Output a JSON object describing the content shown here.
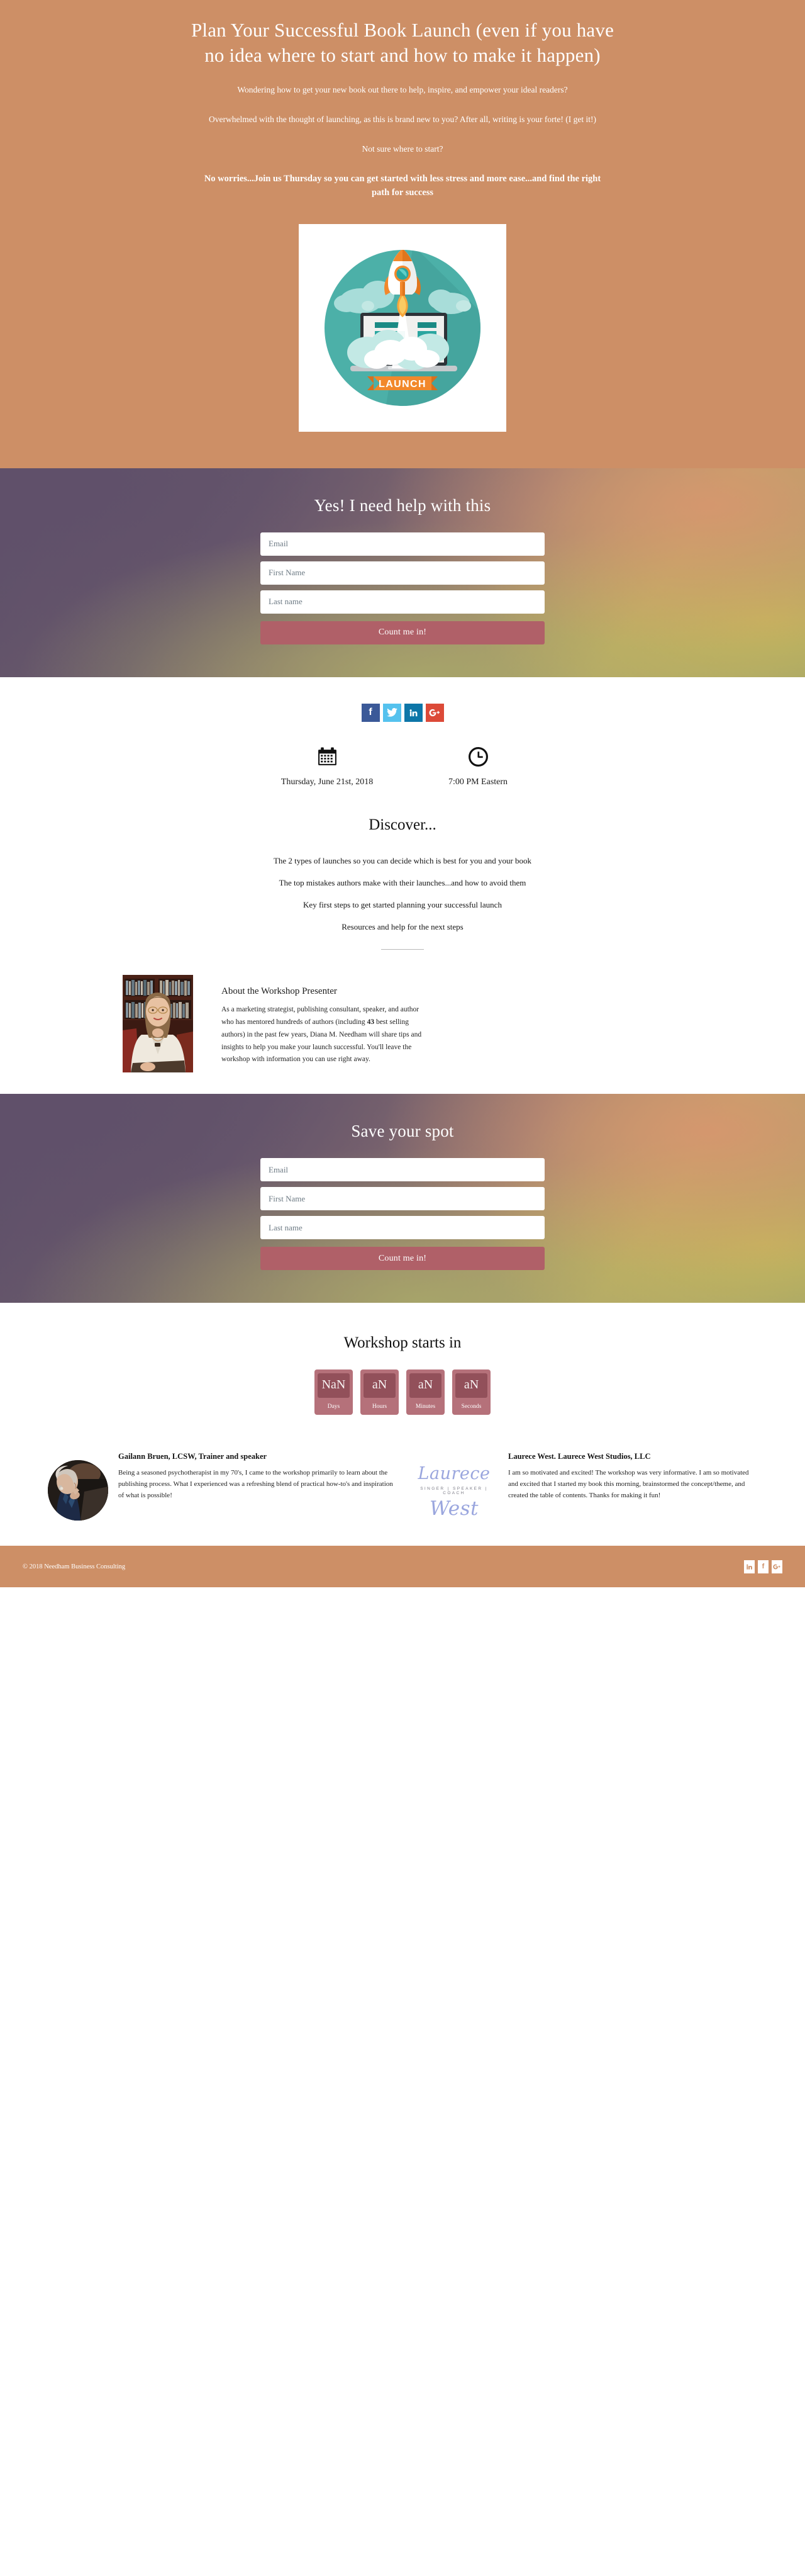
{
  "hero": {
    "title": "Plan Your Successful Book Launch (even if you have no idea where to start and how to make it happen)",
    "sub1": "Wondering how to get your new book out there to help, inspire, and empower your ideal readers?",
    "sub2": "Overwhelmed with the thought of launching, as this is brand new to you? After all, writing is your forte!  (I get it!)",
    "sub3": "Not sure where to start?",
    "sub4": "No worries...Join us Thursday so you can get started with less stress and more ease...and find the right path for success",
    "image_caption": "LAUNCH",
    "bg_color": "#cd8f66"
  },
  "optin_top": {
    "title": "Yes! I need help with this",
    "email_placeholder": "Email",
    "first_name_placeholder": "First Name",
    "last_name_placeholder": "Last name",
    "submit_label": "Count me in!",
    "button_color": "#b06068"
  },
  "social": {
    "items": [
      {
        "name": "facebook",
        "glyph": "f",
        "color": "#3b5998"
      },
      {
        "name": "twitter",
        "glyph": "➤",
        "color": "#55c2ee"
      },
      {
        "name": "linkedin",
        "glyph": "in",
        "color": "#0d76a8"
      },
      {
        "name": "googleplus",
        "glyph": "G+",
        "color": "#dc4a38"
      }
    ]
  },
  "event": {
    "date_icon": "calendar-icon",
    "date": "Thursday, June 21st, 2018",
    "time_icon": "clock-icon",
    "time": "7:00 PM Eastern"
  },
  "discover": {
    "title": "Discover...",
    "items": [
      "The 2 types of launches so you can decide which is best for you and your book",
      "The top mistakes authors make with their launches...and how to avoid them",
      "Key first steps to get started planning your  successful launch",
      "Resources and help for the next steps"
    ]
  },
  "presenter": {
    "heading": "About the Workshop Presenter",
    "bio_part1": "As a marketing strategist, publishing consultant, speaker, and author who has mentored hundreds of authors (including ",
    "bio_highlight": "43",
    "bio_part2": " best selling authors) in the past few years, Diana M. Needham will share tips and insights to help you make your launch successful. You'll leave the workshop with information you can use right away."
  },
  "optin_bottom": {
    "title": "Save your spot",
    "email_placeholder": "Email",
    "first_name_placeholder": "First Name",
    "last_name_placeholder": "Last name",
    "submit_label": "Count me in!"
  },
  "countdown": {
    "title": "Workshop starts in",
    "units": [
      {
        "value": "NaN",
        "label": "Days"
      },
      {
        "value": "aN",
        "label": "Hours"
      },
      {
        "value": "aN",
        "label": "Minutes"
      },
      {
        "value": "aN",
        "label": "Seconds"
      }
    ]
  },
  "testimonials": [
    {
      "name": "Gailann Bruen, LCSW, Trainer and speaker",
      "text": "Being a seasoned psychotherapist in my 70's, I came to the workshop primarily to learn about the publishing process. What I experienced was a refreshing blend of practical how-to's and inspiration of what is possible!"
    },
    {
      "name": "Laurece West. Laurece West Studios, LLC",
      "logo_top": "Laurece",
      "logo_middle": "SINGER | SPEAKER | COACH",
      "logo_bottom": "West",
      "text": "I am so motivated and excited! The workshop was very informative. I am so motivated and excited that I started my book this morning, brainstormed the concept/theme, and created the table of contents. Thanks for making it fun!"
    }
  ],
  "footer": {
    "copyright": "© 2018 Needham Business Consulting",
    "icons": [
      {
        "name": "linkedin",
        "glyph": "in"
      },
      {
        "name": "facebook",
        "glyph": "f"
      },
      {
        "name": "googleplus",
        "glyph": "g+"
      }
    ]
  }
}
